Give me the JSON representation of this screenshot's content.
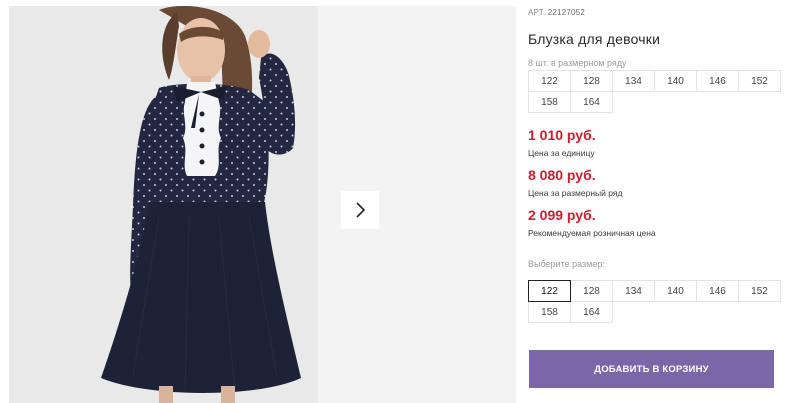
{
  "product": {
    "article_label": "АРТ.",
    "article_value": "22127052",
    "title": "Блузка для девочки",
    "pack_note": "8 шт. в размерном ряду",
    "pack_sizes": [
      "122",
      "128",
      "134",
      "140",
      "146",
      "152",
      "158",
      "164"
    ]
  },
  "prices": {
    "unit_price": "1 010 руб.",
    "unit_label": "Цена за единицу",
    "pack_price": "8 080 руб.",
    "pack_label": "Цена за размерный ряд",
    "retail_price": "2 099 руб.",
    "retail_label": "Рекомендуемая розничная цена"
  },
  "size_select": {
    "label": "Выберите размер:",
    "options": [
      "122",
      "128",
      "134",
      "140",
      "146",
      "152",
      "158",
      "164"
    ],
    "selected": "122"
  },
  "cart": {
    "add_label": "ДОБАВИТЬ В КОРЗИНУ"
  },
  "gallery": {
    "next_icon": "chevron-right-icon",
    "photo_icon": "product-photo"
  },
  "colors": {
    "price": "#cc1d2e",
    "button": "#7b67a8",
    "dress": "#1e2236"
  }
}
